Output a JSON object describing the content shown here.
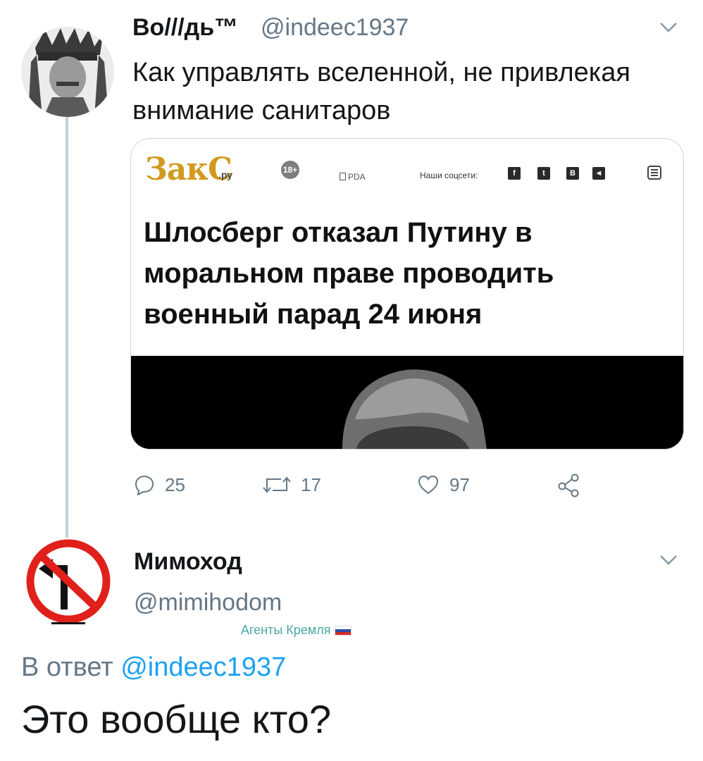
{
  "tweet": {
    "author_name": "Во///дь™",
    "author_handle": "@indeec1937",
    "text": "Как управлять вселенной, не привлекая внимание санитаров",
    "card": {
      "logo": "ЗакС",
      "logo_suffix": ".ру",
      "age_badge": "18+",
      "rda_label": "РDA",
      "social_label": "Наши соцсети:",
      "social_icons": [
        "f",
        "t",
        "В",
        "◄"
      ],
      "title": "Шлосберг отказал Путину в моральном праве проводить военный парад 24 июня"
    },
    "actions": {
      "reply_count": "25",
      "retweet_count": "17",
      "like_count": "97"
    }
  },
  "reply": {
    "author_name": "Мимоход",
    "author_handle": "@mimihodom",
    "badge_text": "Агенты Кремля",
    "in_reply_prefix": "В ответ",
    "in_reply_handle": "@indeec1937",
    "text": "Это вообще кто?"
  },
  "colors": {
    "accent": "#1da1f2",
    "secondary_text": "#657786",
    "thread_line": "#c4cfd6",
    "logo": "#d29a1f",
    "badge": "#4aa7a0",
    "no_turn_red": "#e0201b"
  }
}
